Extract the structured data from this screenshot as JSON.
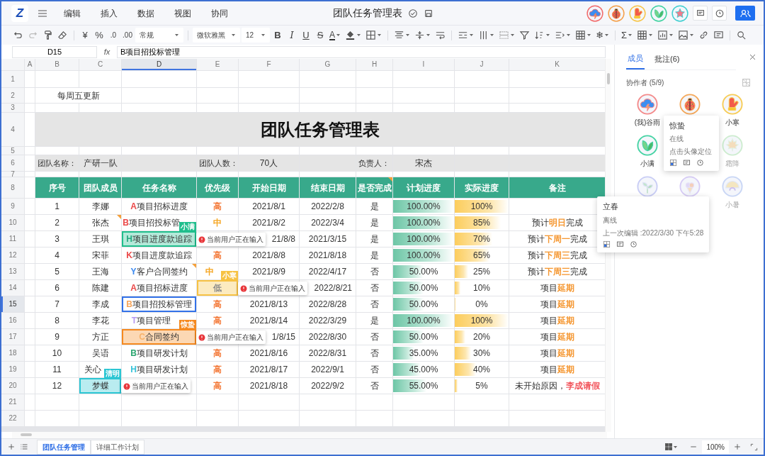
{
  "app": {
    "logo": "Z",
    "menus": [
      "编辑",
      "插入",
      "数据",
      "视图",
      "协同"
    ],
    "title": "团队任务管理表",
    "collaborators": [
      {
        "color": "#f26b6b"
      },
      {
        "color": "#f5a04a"
      },
      {
        "color": "#f7c548"
      },
      {
        "color": "#3fd2a0"
      },
      {
        "color": "#3fcfd0"
      }
    ]
  },
  "toolbar": [
    {
      "kind": "icon",
      "caret": false
    },
    {
      "kind": "icon",
      "caret": false
    },
    {
      "kind": "icon",
      "caret": false
    },
    {
      "kind": "icon",
      "caret": false
    },
    {
      "kind": "sep"
    },
    {
      "kind": "glyph",
      "text": "¥",
      "caret": false
    },
    {
      "kind": "glyph",
      "text": "%",
      "caret": false
    },
    {
      "kind": "glyph",
      "text": ".0",
      "caret": false
    },
    {
      "kind": "glyph",
      "text": ".00",
      "caret": false
    },
    {
      "kind": "dropdown",
      "text": "常规"
    },
    {
      "kind": "sep"
    },
    {
      "kind": "dropdown",
      "text": "微软雅黑"
    },
    {
      "kind": "dropdown",
      "text": "12"
    },
    {
      "kind": "glyph",
      "text": "B",
      "caret": false
    },
    {
      "kind": "glyph",
      "text": "I",
      "caret": false
    },
    {
      "kind": "glyph",
      "text": "U",
      "caret": false
    },
    {
      "kind": "glyph",
      "text": "S",
      "caret": false
    },
    {
      "kind": "glyph",
      "text": "A",
      "caret": true
    },
    {
      "kind": "icon",
      "caret": true
    },
    {
      "kind": "icon",
      "caret": true
    },
    {
      "kind": "sep"
    },
    {
      "kind": "icon",
      "caret": true
    },
    {
      "kind": "icon",
      "caret": true
    },
    {
      "kind": "icon",
      "caret": false
    },
    {
      "kind": "sep"
    },
    {
      "kind": "icon",
      "caret": true
    },
    {
      "kind": "icon",
      "caret": true
    },
    {
      "kind": "icon",
      "caret": true
    },
    {
      "kind": "icon",
      "caret": false
    },
    {
      "kind": "icon",
      "caret": true
    },
    {
      "kind": "icon",
      "caret": true
    },
    {
      "kind": "icon",
      "caret": true
    },
    {
      "kind": "glyph",
      "text": "❄",
      "caret": true
    },
    {
      "kind": "sep"
    },
    {
      "kind": "glyph",
      "text": "Σ",
      "caret": true
    },
    {
      "kind": "icon",
      "caret": true
    },
    {
      "kind": "icon",
      "caret": true
    },
    {
      "kind": "icon",
      "caret": true
    },
    {
      "kind": "icon",
      "caret": false
    },
    {
      "kind": "icon",
      "caret": false
    },
    {
      "kind": "sep"
    },
    {
      "kind": "icon",
      "caret": false
    }
  ],
  "formula_bar": {
    "cell": "D15",
    "label": "fx",
    "value": "B项目招投标管理"
  },
  "columns": [
    {
      "label": "A",
      "selected": false
    },
    {
      "label": "B",
      "selected": false
    },
    {
      "label": "C",
      "selected": false
    },
    {
      "label": "D",
      "selected": true
    },
    {
      "label": "E",
      "selected": false
    },
    {
      "label": "F",
      "selected": false
    },
    {
      "label": "G",
      "selected": false
    },
    {
      "label": "H",
      "selected": false
    },
    {
      "label": "I",
      "selected": false
    },
    {
      "label": "J",
      "selected": false
    },
    {
      "label": "K",
      "selected": false
    }
  ],
  "row_numbers": [
    {
      "label": "1",
      "selected": false
    },
    {
      "label": "2",
      "selected": false
    },
    {
      "label": "3",
      "selected": false
    },
    {
      "label": "4",
      "selected": false
    },
    {
      "label": "5",
      "selected": false
    },
    {
      "label": "6",
      "selected": false
    },
    {
      "label": "7",
      "selected": false
    },
    {
      "label": "8",
      "selected": false
    },
    {
      "label": "9",
      "selected": false
    },
    {
      "label": "10",
      "selected": false
    },
    {
      "label": "11",
      "selected": false
    },
    {
      "label": "12",
      "selected": false
    },
    {
      "label": "13",
      "selected": false
    },
    {
      "label": "14",
      "selected": false
    },
    {
      "label": "15",
      "selected": true
    },
    {
      "label": "16",
      "selected": false
    },
    {
      "label": "17",
      "selected": false
    },
    {
      "label": "18",
      "selected": false
    },
    {
      "label": "19",
      "selected": false
    },
    {
      "label": "20",
      "selected": false
    },
    {
      "label": "21",
      "selected": false
    },
    {
      "label": "22",
      "selected": false
    }
  ],
  "sheet": {
    "note": "每周五更新",
    "title": "团队任务管理表",
    "info": [
      {
        "label": "团队名称：",
        "value": "产研一队"
      },
      {
        "label": "团队人数：",
        "value": "70人"
      },
      {
        "label": "负责人：",
        "value": "宋杰"
      }
    ],
    "header": [
      {
        "text": "序号",
        "comment": false
      },
      {
        "text": "团队成员",
        "comment": false
      },
      {
        "text": "任务名称",
        "comment": false
      },
      {
        "text": "优先级",
        "comment": false
      },
      {
        "text": "开始日期",
        "comment": false
      },
      {
        "text": "结束日期",
        "comment": false
      },
      {
        "text": "是否完成",
        "comment": true
      },
      {
        "text": "计划进度",
        "comment": false
      },
      {
        "text": "实际进度",
        "comment": false
      },
      {
        "text": "备注",
        "comment": false
      }
    ],
    "rows": [
      {
        "no": "1",
        "member": "李娜",
        "member_comment": false,
        "task": {
          "letter": "A",
          "color": "#eb4848",
          "text": "项目招标进度",
          "selected": false
        },
        "task_comment": false,
        "priority": {
          "text": "高",
          "color": "#f47c3c"
        },
        "start": "2021/8/1",
        "end": "2022/2/8",
        "done": "是",
        "plan": {
          "reading": "100.00%",
          "level": 1
        },
        "actual": {
          "reading": "100%",
          "level": 1
        }
      },
      {
        "no": "2",
        "member": "张杰",
        "member_comment": true,
        "task": {
          "letter": "B",
          "color": "#eb4848",
          "text": "项目招投标管",
          "selected": false
        },
        "task_comment": false,
        "priority": {
          "text": "中",
          "color": "#f5a623"
        },
        "start": "2021/8/2",
        "end": "2022/3/4",
        "done": "是",
        "plan": {
          "reading": "100.00%",
          "level": 1
        },
        "actual": {
          "reading": "85%",
          "level": 0.85
        },
        "note": [
          {
            "text": "预计"
          },
          {
            "text": "明日",
            "color": "#f5962f"
          },
          {
            "text": "完成"
          }
        ]
      },
      {
        "no": "3",
        "member": "王琪",
        "member_comment": false,
        "task": {
          "letter": "H",
          "color": "#25a980",
          "text": "项目进度款追踪",
          "selected": false
        },
        "task_comment": false,
        "task_cursor": {
          "name": "小满",
          "color": "#1fbe8c",
          "notice": "当前用户正在输入"
        },
        "start": "21/8/8",
        "end": "2021/3/15",
        "done": "是",
        "plan": {
          "reading": "100.00%",
          "level": 1
        },
        "actual": {
          "reading": "70%",
          "level": 0.7
        },
        "note": [
          {
            "text": "预计"
          },
          {
            "text": "下周一",
            "color": "#f5962f"
          },
          {
            "text": "完成"
          }
        ]
      },
      {
        "no": "4",
        "member": "宋菲",
        "member_comment": false,
        "task": {
          "letter": "K",
          "color": "#eb4848",
          "text": "项目进度款追踪",
          "selected": false
        },
        "task_comment": false,
        "priority": {
          "text": "高",
          "color": "#f47c3c"
        },
        "start": "2021/8/8",
        "end": "2021/8/18",
        "done": "是",
        "plan": {
          "reading": "100.00%",
          "level": 1
        },
        "actual": {
          "reading": "65%",
          "level": 0.65
        },
        "note": [
          {
            "text": "预计"
          },
          {
            "text": "下周三",
            "color": "#f5962f"
          },
          {
            "text": "完成"
          }
        ]
      },
      {
        "no": "5",
        "member": "王海",
        "member_comment": false,
        "task": {
          "letter": "Y",
          "color": "#3d8af0",
          "text": "客户合同签约",
          "selected": false
        },
        "task_comment": true,
        "priority": {
          "text": "中",
          "color": "#f5a623"
        },
        "start": "2021/8/9",
        "end": "2022/4/17",
        "done": "否",
        "plan": {
          "reading": "50.00%",
          "level": 0.5
        },
        "actual": {
          "reading": "25%",
          "level": 0.25
        },
        "note": [
          {
            "text": "预计"
          },
          {
            "text": "下周三",
            "color": "#f5962f"
          },
          {
            "text": "完成"
          }
        ]
      },
      {
        "no": "6",
        "member": "陈建",
        "member_comment": false,
        "task": {
          "letter": "A",
          "color": "#eb4848",
          "text": "项目招标进度",
          "selected": false
        },
        "task_comment": false,
        "priority": {
          "text": "低",
          "color": "#8a8a8a"
        },
        "priority_cursor": {
          "name": "小寒",
          "color": "#f7c243",
          "notice": "当前用户正在输入"
        },
        "end": "2022/8/21",
        "done": "否",
        "plan": {
          "reading": "50.00%",
          "level": 0.5
        },
        "actual": {
          "reading": "10%",
          "level": 0.1
        },
        "note": [
          {
            "text": "项目"
          },
          {
            "text": "延期",
            "color": "#f5962f"
          }
        ]
      },
      {
        "no": "7",
        "member": "李成",
        "member_comment": false,
        "task": {
          "letter": "B",
          "color": "#f7a55a",
          "text": "项目招投标管理",
          "selected": true
        },
        "task_comment": false,
        "priority": {
          "text": "高",
          "color": "#f47c3c"
        },
        "start": "2021/8/13",
        "end": "2022/8/28",
        "done": "否",
        "plan": {
          "reading": "50.00%",
          "level": 0.5
        },
        "actual": {
          "reading": "0%",
          "level": 0
        },
        "note": [
          {
            "text": "项目"
          },
          {
            "text": "延期",
            "color": "#f5962f"
          }
        ]
      },
      {
        "no": "8",
        "member": "李花",
        "member_comment": false,
        "task": {
          "letter": "T",
          "color": "#b89af2",
          "text": "项目管理",
          "selected": false
        },
        "task_comment": false,
        "priority": {
          "text": "高",
          "color": "#f47c3c"
        },
        "start": "2021/8/14",
        "end": "2022/3/29",
        "done": "是",
        "plan": {
          "reading": "100.00%",
          "level": 1
        },
        "actual": {
          "reading": "100%",
          "level": 1
        },
        "note": [
          {
            "text": "项目"
          },
          {
            "text": "延期",
            "color": "#f5962f"
          }
        ]
      },
      {
        "no": "9",
        "member": "方正",
        "member_comment": false,
        "task": {
          "letter": "C",
          "color": "#f7b26a",
          "text": "合同签约",
          "selected": false
        },
        "task_comment": false,
        "task_cursor": {
          "name": "惊蛰",
          "color": "#f5891f",
          "notice": "当前用户正在输入"
        },
        "start": "1/8/15",
        "end": "2022/8/30",
        "done": "否",
        "plan": {
          "reading": "50.00%",
          "level": 0.5
        },
        "actual": {
          "reading": "20%",
          "level": 0.2
        },
        "note": [
          {
            "text": "项目"
          },
          {
            "text": "延期",
            "color": "#f5962f"
          }
        ]
      },
      {
        "no": "10",
        "member": "吴语",
        "member_comment": false,
        "task": {
          "letter": "B",
          "color": "#2aa56f",
          "text": "项目研发计划",
          "selected": false
        },
        "task_comment": false,
        "priority": {
          "text": "高",
          "color": "#f47c3c"
        },
        "start": "2021/8/16",
        "end": "2022/8/31",
        "done": "否",
        "plan": {
          "reading": "35.00%",
          "level": 0.35
        },
        "actual": {
          "reading": "30%",
          "level": 0.3
        },
        "note": [
          {
            "text": "项目"
          },
          {
            "text": "延期",
            "color": "#f5962f"
          }
        ]
      },
      {
        "no": "11",
        "member": "关心",
        "member_comment": false,
        "task": {
          "letter": "H",
          "color": "#36c3d9",
          "text": "项目研发计划",
          "selected": false
        },
        "task_comment": false,
        "priority": {
          "text": "高",
          "color": "#f47c3c"
        },
        "start": "2021/8/17",
        "end": "2022/9/1",
        "done": "否",
        "plan": {
          "reading": "45.00%",
          "level": 0.45
        },
        "actual": {
          "reading": "40%",
          "level": 0.4
        },
        "note": [
          {
            "text": "项目"
          },
          {
            "text": "延期",
            "color": "#f5962f"
          }
        ]
      },
      {
        "no": "12",
        "member": "梦蝶",
        "member_comment": false,
        "member_cursor": {
          "name": "清明",
          "color": "#2cc6d3",
          "notice": "当前用户正在输入"
        },
        "task_comment": false,
        "priority": {
          "text": "高",
          "color": "#f47c3c"
        },
        "start": "2021/8/18",
        "end": "2022/9/2",
        "done": "否",
        "plan": {
          "reading": "55.00%",
          "level": 0.55
        },
        "actual": {
          "reading": "5%",
          "level": 0.05
        },
        "note": [
          {
            "text": "未开始原因，"
          },
          {
            "text": "李成请假",
            "color": "#f2545b"
          }
        ]
      }
    ]
  },
  "panel": {
    "tabs": [
      {
        "label": "成员",
        "selected": true
      },
      {
        "label": "批注(6)",
        "selected": false
      }
    ],
    "heading": "协作者 (5/9)",
    "members": [
      {
        "kind": "member",
        "name": "(我)谷雨",
        "online": true,
        "color": "#f48a8a"
      },
      {
        "kind": "member",
        "online": true,
        "color": "#f5a85a"
      },
      {
        "kind": "member",
        "name": "小寒",
        "online": true,
        "color": "#f7cc55"
      },
      {
        "kind": "member",
        "name": "小满",
        "online": true,
        "color": "#45d3a3"
      },
      {
        "kind": "popover",
        "name": "惊蛰",
        "status": "在线",
        "hint": "点击头像定位"
      },
      {
        "kind": "member",
        "name": "霜降",
        "online": false,
        "color": "#cdeccf"
      },
      {
        "kind": "member",
        "online": false,
        "color": "#c9cdf5"
      },
      {
        "kind": "member",
        "online": false,
        "color": "#d7ccf5"
      },
      {
        "kind": "member",
        "name": "小暑",
        "online": false,
        "color": "#c9d6f5"
      }
    ]
  },
  "status_card": {
    "name": "立春",
    "status": "离线",
    "hint": "上一次编辑 :2022/3/30 下午5:28"
  },
  "sheet_tabs": [
    {
      "label": "团队任务管理",
      "selected": true
    },
    {
      "label": "详细工作计划",
      "selected": false
    }
  ],
  "zoom": "100%"
}
